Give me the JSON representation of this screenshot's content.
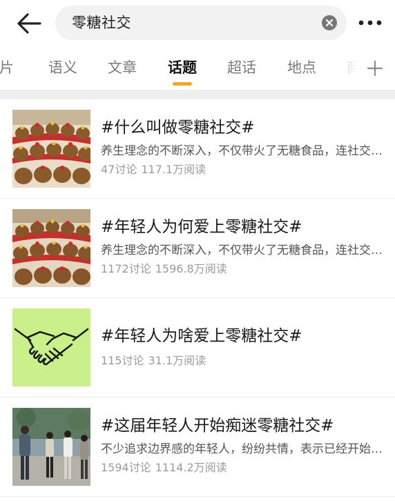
{
  "search": {
    "query": "零糖社交"
  },
  "tabs": [
    {
      "label": "图片",
      "active": false
    },
    {
      "label": "语义",
      "active": false
    },
    {
      "label": "文章",
      "active": false
    },
    {
      "label": "话题",
      "active": true
    },
    {
      "label": "超话",
      "active": false
    },
    {
      "label": "地点",
      "active": false
    },
    {
      "label": "商品",
      "active": false
    }
  ],
  "colors": {
    "accent": "#f6a623",
    "tab_active": "#111111",
    "tab_inactive": "#7a7a7a",
    "stats": "#9a9a9a"
  },
  "icons": {
    "back": "arrow-left-icon",
    "clear": "clear-circle-icon",
    "more": "more-dots-icon",
    "add_tab": "plus-icon"
  },
  "topics": [
    {
      "title": "#什么叫做零糖社交#",
      "description": "养生理念的不断深入，不仅带火了无糖食品，连社交也开始无糖化",
      "discussions": "47讨论",
      "reads": "117.1万阅读",
      "thumbnail": "plush-capybara-display"
    },
    {
      "title": "#年轻人为何爱上零糖社交#",
      "description": "养生理念的不断深入，不仅带火了无糖食品，连社交也开始无糖化",
      "discussions": "1172讨论",
      "reads": "1596.8万阅读",
      "thumbnail": "plush-capybara-display"
    },
    {
      "title": "#年轻人为啥爱上零糖社交#",
      "description": "",
      "discussions": "115讨论",
      "reads": "31.1万阅读",
      "thumbnail": "handshake-illustration"
    },
    {
      "title": "#这届年轻人开始痴迷零糖社交#",
      "description": "不少追求边界感的年轻人，纷纷共情，表示已经开始零糖社交",
      "discussions": "1594讨论",
      "reads": "1114.2万阅读",
      "thumbnail": "people-outdoor-photo"
    }
  ]
}
